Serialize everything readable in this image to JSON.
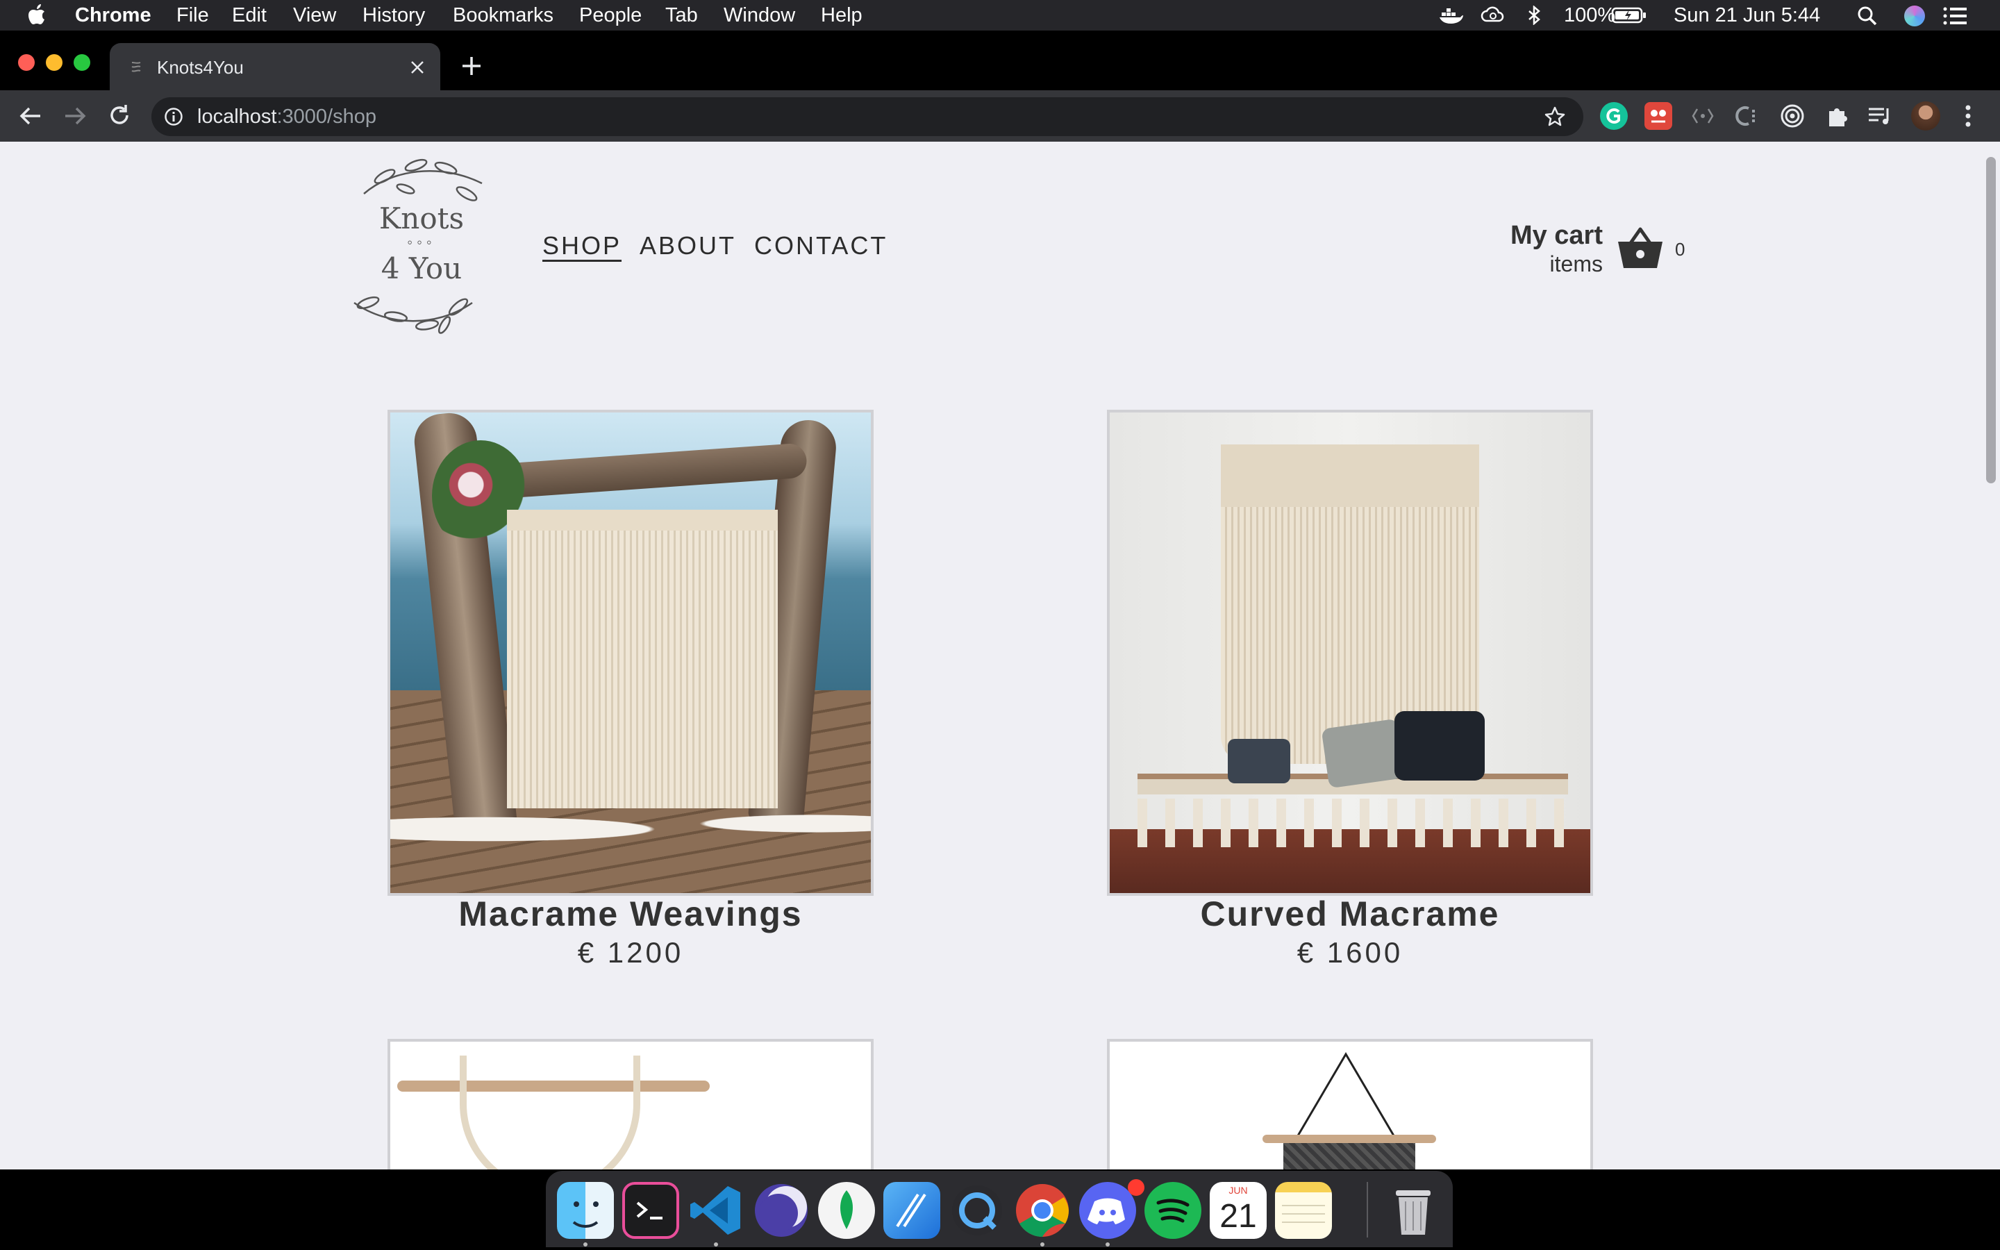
{
  "menubar": {
    "app": "Chrome",
    "items": [
      "File",
      "Edit",
      "View",
      "History",
      "Bookmarks",
      "People",
      "Tab",
      "Window",
      "Help"
    ],
    "battery": "100%",
    "clock": "Sun 21 Jun  5:44"
  },
  "browser": {
    "tab_title": "Knots4You",
    "url_host": "localhost",
    "url_path": ":3000/shop"
  },
  "site": {
    "logo_line1": "Knots",
    "logo_dots": "◦◦◦",
    "logo_line2": "4 You",
    "nav": [
      "SHOP",
      "ABOUT",
      "CONTACT"
    ],
    "cart_title": "My cart",
    "cart_sub": "items",
    "cart_count": "0"
  },
  "products": [
    {
      "name": "Macrame Weavings",
      "price": "€ 1200"
    },
    {
      "name": "Curved Macrame",
      "price": "€ 1600"
    }
  ],
  "dock": {
    "calendar_month": "JUN",
    "calendar_day": "21"
  }
}
